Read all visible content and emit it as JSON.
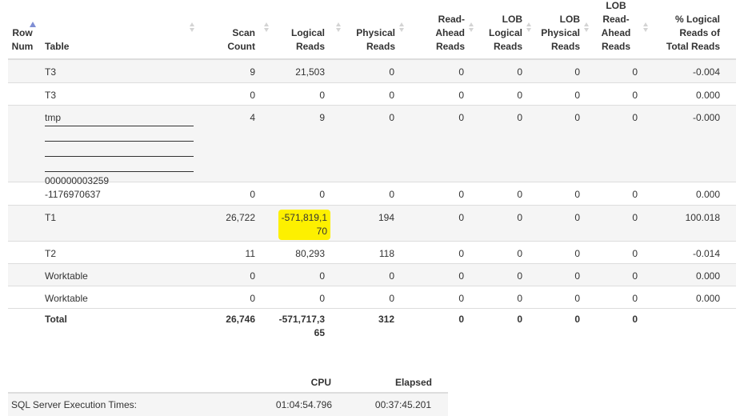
{
  "columns": {
    "row_num": [
      "Row",
      "Num"
    ],
    "table": "Table",
    "scan_count": [
      "Scan",
      "Count"
    ],
    "logical_reads": [
      "Logical",
      "Reads"
    ],
    "physical_reads": [
      "Physical",
      "Reads"
    ],
    "read_ahead": [
      "Read-",
      "Ahead",
      "Reads"
    ],
    "lob_logical": [
      "LOB",
      "Logical",
      "Reads"
    ],
    "lob_physical": [
      "LOB",
      "Physical",
      "Reads"
    ],
    "lob_read_ahead": [
      "LOB",
      "Read-",
      "Ahead",
      "Reads"
    ],
    "pct": [
      "% Logical",
      "Reads of",
      "Total Reads"
    ]
  },
  "rows": [
    {
      "table": "T3",
      "scan": "9",
      "logical": "21,503",
      "physical": "0",
      "ra": "0",
      "lobl": "0",
      "lobp": "0",
      "lobra": "0",
      "pct": "-0.004"
    },
    {
      "table": "T3",
      "scan": "0",
      "logical": "0",
      "physical": "0",
      "ra": "0",
      "lobl": "0",
      "lobp": "0",
      "lobra": "0",
      "pct": "0.000"
    },
    {
      "table_prefix": "tmp",
      "table_suffix": "000000003259",
      "scan": "4",
      "logical": "9",
      "physical": "0",
      "ra": "0",
      "lobl": "0",
      "lobp": "0",
      "lobra": "0",
      "pct": "-0.000"
    },
    {
      "table": "-1176970637",
      "scan": "0",
      "logical": "0",
      "physical": "0",
      "ra": "0",
      "lobl": "0",
      "lobp": "0",
      "lobra": "0",
      "pct": "0.000"
    },
    {
      "table": "T1",
      "scan": "26,722",
      "logical_l1": "-571,819,1",
      "logical_l2": "70",
      "physical": "194",
      "ra": "0",
      "lobl": "0",
      "lobp": "0",
      "lobra": "0",
      "pct": "100.018"
    },
    {
      "table": "T2",
      "scan": "11",
      "logical": "80,293",
      "physical": "118",
      "ra": "0",
      "lobl": "0",
      "lobp": "0",
      "lobra": "0",
      "pct": "-0.014"
    },
    {
      "table": "Worktable",
      "scan": "0",
      "logical": "0",
      "physical": "0",
      "ra": "0",
      "lobl": "0",
      "lobp": "0",
      "lobra": "0",
      "pct": "0.000"
    },
    {
      "table": "Worktable",
      "scan": "0",
      "logical": "0",
      "physical": "0",
      "ra": "0",
      "lobl": "0",
      "lobp": "0",
      "lobra": "0",
      "pct": "0.000"
    }
  ],
  "total": {
    "label": "Total",
    "scan": "26,746",
    "logical_l1": "-571,717,3",
    "logical_l2": "65",
    "physical": "312",
    "ra": "0",
    "lobl": "0",
    "lobp": "0",
    "lobra": "0"
  },
  "exec": {
    "cpu_header": "CPU",
    "elapsed_header": "Elapsed",
    "label": "SQL Server Execution Times:",
    "cpu": "01:04:54.796",
    "elapsed": "00:37:45.201"
  },
  "colors": {
    "highlight": "#fdf000",
    "stripe": "#f5f5f5",
    "border": "#dddddd",
    "sort_active": "#7f8ed4"
  }
}
